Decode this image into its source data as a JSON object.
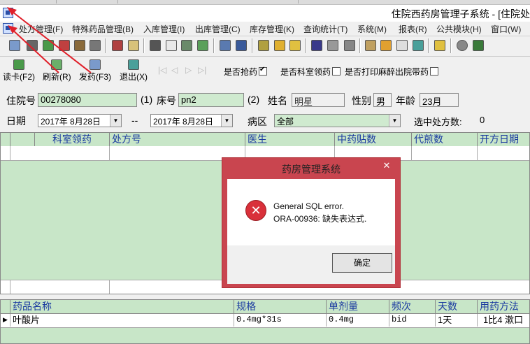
{
  "window": {
    "title": "住院西药房管理子系统 - [住院处"
  },
  "menu": [
    "处方管理(F)",
    "特殊药品管理(B)",
    "入库管理(I)",
    "出库管理(C)",
    "库存管理(K)",
    "查询统计(T)",
    "系统(M)",
    "报表(R)",
    "公共模块(H)",
    "窗口(W)"
  ],
  "actions": {
    "read_card": "读卡(F2)",
    "refresh": "刷新(R)",
    "dispense": "发药(F3)",
    "exit": "退出(X)"
  },
  "nav_glyphs": {
    "first": "|◁",
    "prev": "◁",
    "next": "▷",
    "last": "▷|"
  },
  "checks": {
    "grab": {
      "label": "是否抢药",
      "checked": true
    },
    "dept": {
      "label": "是否科室领药",
      "checked": false
    },
    "anesthesia": {
      "label": "是否打印麻醉出院带药",
      "checked": false
    }
  },
  "form": {
    "admission_label": "住院号",
    "admission_value": "00278080",
    "marker1": "(1)",
    "bed_label": "床号",
    "bed_value": "pn2",
    "marker2": "(2)",
    "name_label": "姓名",
    "name_value": "明星",
    "sex_label": "性别",
    "sex_value": "男",
    "age_label": "年龄",
    "age_value": "23月",
    "date_label": "日期",
    "date_from": "2017年 8月28日",
    "date_sep": "--",
    "date_to": "2017年 8月28日",
    "ward_label": "病区",
    "ward_value": "全部",
    "selected_label": "选中处方数:",
    "selected_value": "0"
  },
  "top_grid": {
    "headers": [
      "科室领药",
      "处方号",
      "医生",
      "中药贴数",
      "代煎数",
      "开方日期"
    ]
  },
  "bottom_grid": {
    "headers": [
      "药品名称",
      "规格",
      "单剂量",
      "频次",
      "天数",
      "用药方法"
    ],
    "rows": [
      [
        "叶酸片",
        "0.4mg*31s",
        "0.4mg",
        "bid",
        "1天",
        "1比4 漱口"
      ]
    ]
  },
  "dialog": {
    "title": "药房管理系统",
    "close": "✕",
    "line1": "General SQL error.",
    "line2": "ORA-00936: 缺失表达式.",
    "ok": "确定"
  },
  "colors": {
    "grid_bg": "#c8e6c8",
    "field_bg": "#cfeacf",
    "dialog_frame": "#c9454f",
    "arrow": "#e0202a",
    "header_text": "#1a3aa0"
  }
}
